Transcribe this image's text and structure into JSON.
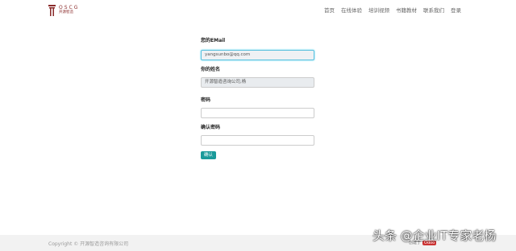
{
  "header": {
    "brand": "OSCG",
    "brand_sub": "开源智造",
    "nav": [
      "首页",
      "在线体验",
      "培训视频",
      "书籍教材",
      "联系我们",
      "登录"
    ]
  },
  "form": {
    "email_label": "您的EMail",
    "email_value": "yangsunbo@qq.com",
    "name_label": "你的姓名",
    "name_value": "开源智造咨询公司,杨",
    "password_label": "密码",
    "confirm_label": "确认密码",
    "submit_label": "确认"
  },
  "footer": {
    "copyright": "Copyright © 开源智造咨询有限公司",
    "powered_prefix": "创建于",
    "powered_badge": "Odoo"
  },
  "watermark": "头条 @企业IT专家老杨"
}
